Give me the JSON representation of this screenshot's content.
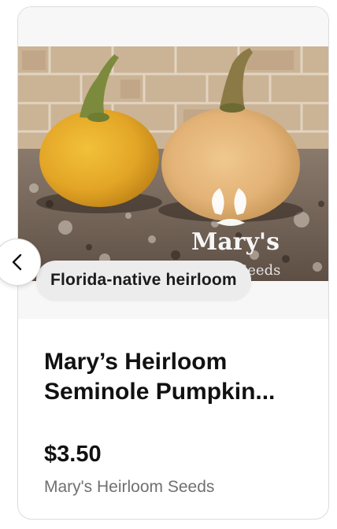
{
  "product": {
    "badge": "Florida-native heirloom",
    "title": "Mary’s Heirloom Seminole Pumpkin...",
    "price": "$3.50",
    "seller": "Mary's Heirloom Seeds",
    "image_watermark": "Mary's Heirloom Seeds"
  },
  "controls": {
    "prev_icon": "chevron-left-icon"
  },
  "colors": {
    "pumpkin_orange": "#e3a526",
    "pumpkin_tan": "#e3b276",
    "badge_bg": "#ececec",
    "seller_gray": "#707070"
  }
}
